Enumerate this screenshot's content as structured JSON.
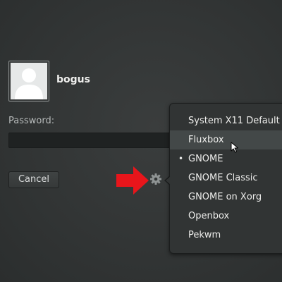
{
  "user": {
    "name": "bogus"
  },
  "login": {
    "password_label": "Password:",
    "password_value": "",
    "cancel_label": "Cancel"
  },
  "session_menu": {
    "items": [
      {
        "label": "System X11 Default"
      },
      {
        "label": "Fluxbox"
      },
      {
        "label": "GNOME"
      },
      {
        "label": "GNOME Classic"
      },
      {
        "label": "GNOME on Xorg"
      },
      {
        "label": "Openbox"
      },
      {
        "label": "Pekwm"
      }
    ],
    "hovered_item": "Fluxbox",
    "selected_item": "GNOME"
  },
  "colors": {
    "background": "#323535",
    "popover": "#313434",
    "hover_row": "#434848",
    "annotation_arrow": "#e8151b"
  },
  "icons": {
    "avatar": "user-avatar-icon",
    "settings": "gear-icon",
    "annotation": "red-arrow-icon",
    "pointer": "mouse-cursor-icon"
  }
}
